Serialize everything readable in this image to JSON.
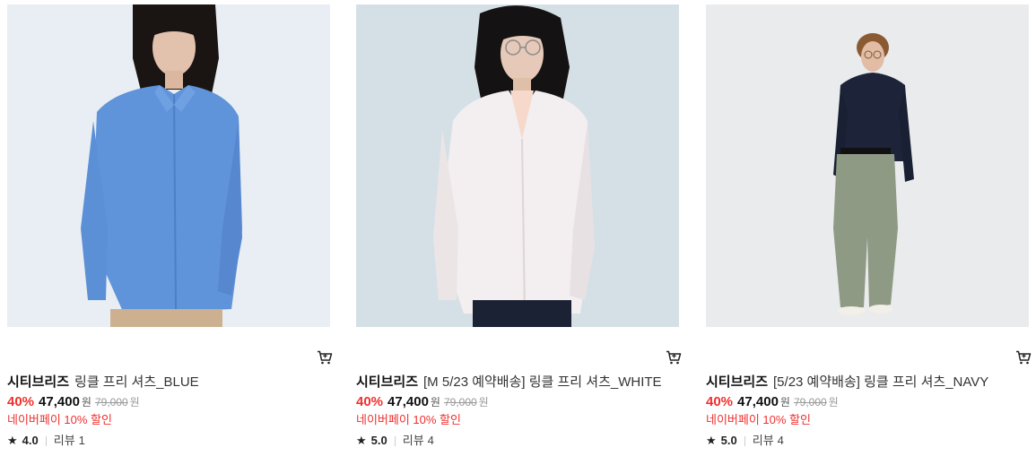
{
  "products": [
    {
      "brand": "시티브리즈",
      "name": "링클 프리 셔츠_BLUE",
      "discount": "40%",
      "price": "47,400",
      "currency": "원",
      "original_price": "79,000",
      "promo": "네이버페이 10% 할인",
      "rating": "4.0",
      "review_label": "리뷰",
      "review_count": "1",
      "shirt_color": "#5f93da",
      "bg_color": "#e8eef3"
    },
    {
      "brand": "시티브리즈",
      "name": "[M 5/23 예약배송] 링클 프리 셔츠_WHITE",
      "discount": "40%",
      "price": "47,400",
      "currency": "원",
      "original_price": "79,000",
      "promo": "네이버페이 10% 할인",
      "rating": "5.0",
      "review_label": "리뷰",
      "review_count": "4",
      "shirt_color": "#f3eeef",
      "bg_color": "#d5e0e6"
    },
    {
      "brand": "시티브리즈",
      "name": "[5/23 예약배송] 링클 프리 셔츠_NAVY",
      "discount": "40%",
      "price": "47,400",
      "currency": "원",
      "original_price": "79,000",
      "promo": "네이버페이 10% 할인",
      "rating": "5.0",
      "review_label": "리뷰",
      "review_count": "4",
      "shirt_color": "#1d2338",
      "bg_color": "#e9ebed"
    }
  ],
  "icons": {
    "cart": "cart-icon",
    "star": "★"
  }
}
